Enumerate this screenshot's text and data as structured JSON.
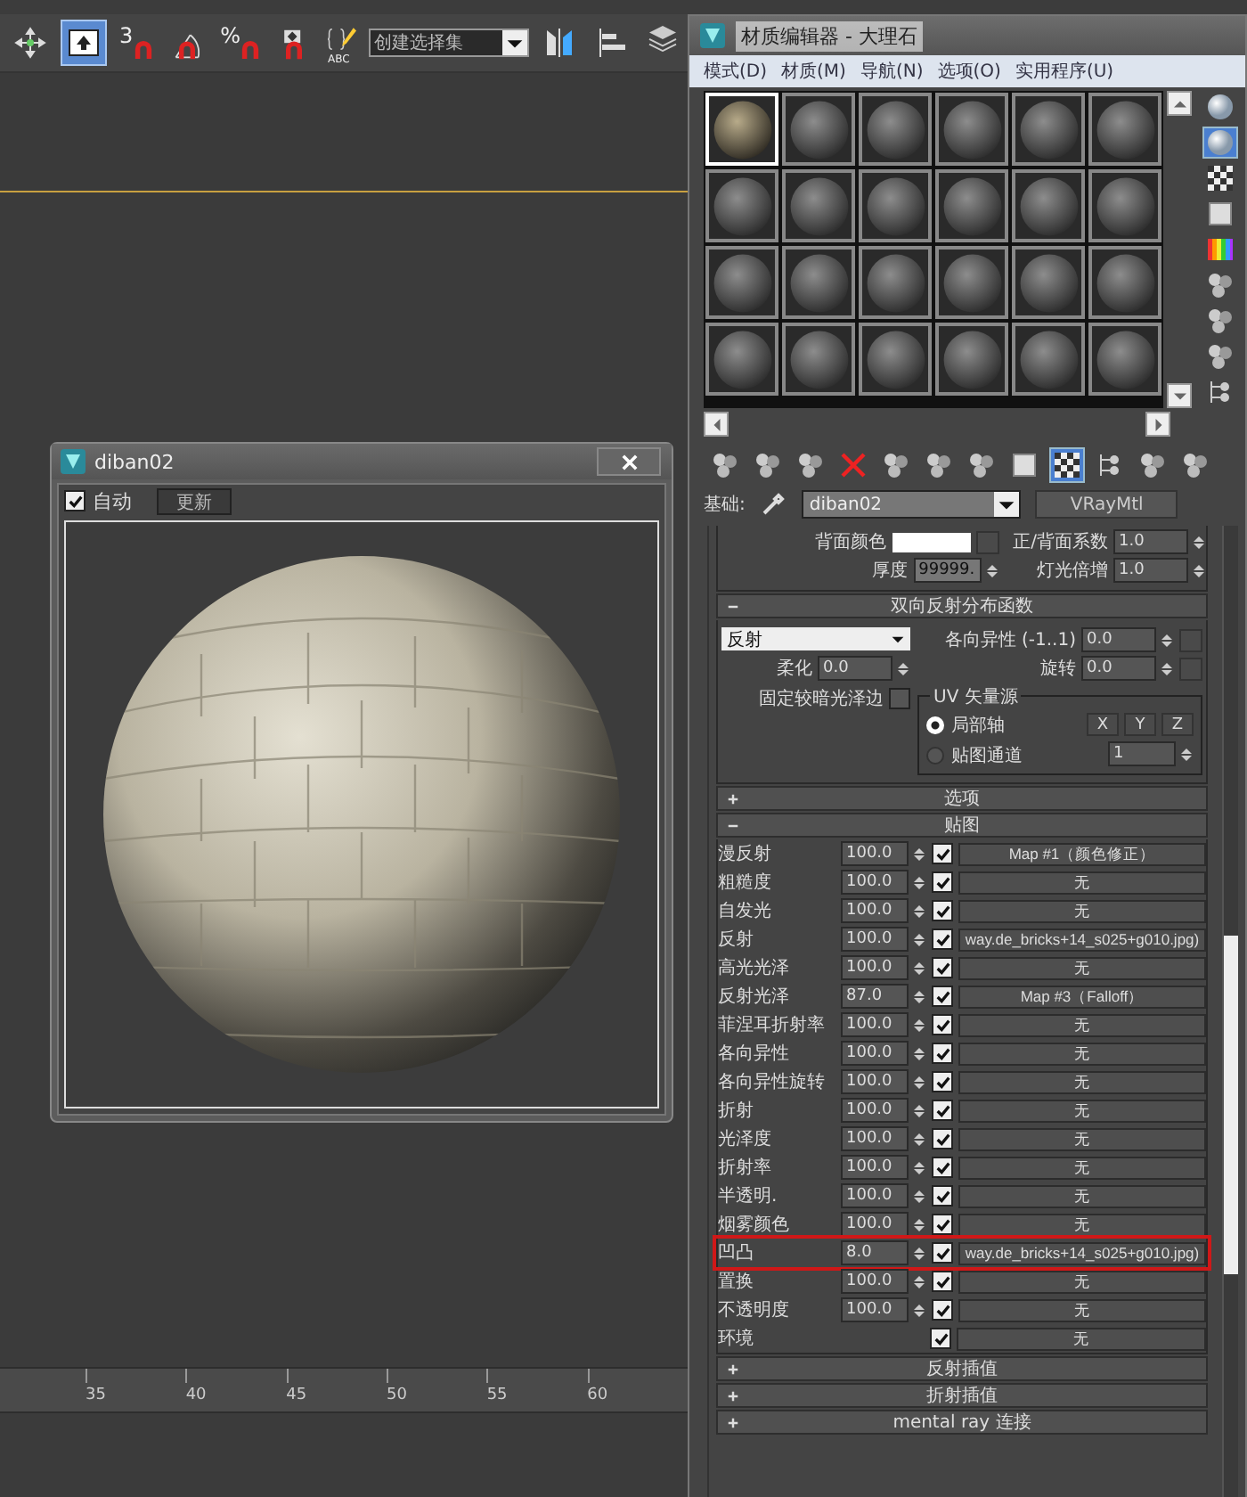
{
  "toolbar": {
    "items": [
      {
        "kind": "move",
        "selected": false
      },
      {
        "kind": "select-window",
        "selected": true
      },
      {
        "kind": "snap",
        "label": "3",
        "selected": false
      },
      {
        "kind": "angle-snap",
        "selected": false
      },
      {
        "kind": "percent-snap",
        "label": "%",
        "selected": false
      },
      {
        "kind": "spinner-snap",
        "selected": false
      },
      {
        "kind": "named-sets",
        "label": "ABC",
        "selected": false
      }
    ],
    "selection_set": "创建选择集",
    "tail": [
      {
        "kind": "mirror"
      },
      {
        "kind": "align"
      },
      {
        "kind": "layers"
      }
    ]
  },
  "timeline": {
    "ticks": [
      "35",
      "40",
      "45",
      "50",
      "55",
      "60"
    ]
  },
  "preview_window": {
    "title": "diban02",
    "auto_update": {
      "label": "自动",
      "checked": true
    },
    "update_button": "更新"
  },
  "material_editor": {
    "title": "材质编辑器 - 大理石",
    "menu": [
      "模式(D)",
      "材质(M)",
      "导航(N)",
      "选项(O)",
      "实用程序(U)"
    ],
    "slots": [
      {
        "kind": "textured",
        "selected": true
      },
      {
        "kind": "plain",
        "selected": false
      },
      {
        "kind": "plain",
        "selected": false
      },
      {
        "kind": "plain",
        "selected": false
      },
      {
        "kind": "plain",
        "selected": false
      },
      {
        "kind": "plain",
        "selected": false
      },
      {
        "kind": "plain",
        "selected": false
      },
      {
        "kind": "plain",
        "selected": false
      },
      {
        "kind": "plain",
        "selected": false
      },
      {
        "kind": "plain",
        "selected": false
      },
      {
        "kind": "plain",
        "selected": false
      },
      {
        "kind": "plain",
        "selected": false
      },
      {
        "kind": "plain",
        "selected": false
      },
      {
        "kind": "plain",
        "selected": false
      },
      {
        "kind": "plain",
        "selected": false
      },
      {
        "kind": "plain",
        "selected": false
      },
      {
        "kind": "plain",
        "selected": false
      },
      {
        "kind": "plain",
        "selected": false
      },
      {
        "kind": "plain",
        "selected": false
      },
      {
        "kind": "plain",
        "selected": false
      },
      {
        "kind": "plain",
        "selected": false
      },
      {
        "kind": "plain",
        "selected": false
      },
      {
        "kind": "plain",
        "selected": false
      },
      {
        "kind": "plain",
        "selected": false
      }
    ],
    "side_tools": [
      {
        "kind": "sphere",
        "selected": false
      },
      {
        "kind": "sphere",
        "selected": true
      },
      {
        "kind": "checker",
        "selected": false
      },
      {
        "kind": "square",
        "selected": false
      },
      {
        "kind": "color-bars",
        "selected": false
      },
      {
        "kind": "dots",
        "selected": false
      },
      {
        "kind": "dots",
        "selected": false
      },
      {
        "kind": "dots",
        "selected": false
      },
      {
        "kind": "tree",
        "selected": false
      }
    ],
    "bottom_tools": [
      {
        "kind": "dots",
        "selected": false
      },
      {
        "kind": "dots",
        "selected": false
      },
      {
        "kind": "dots",
        "selected": false
      },
      {
        "kind": "cross",
        "selected": false
      },
      {
        "kind": "dots",
        "selected": false
      },
      {
        "kind": "dots",
        "selected": false
      },
      {
        "kind": "dots",
        "selected": false
      },
      {
        "kind": "square",
        "selected": false
      },
      {
        "kind": "checker",
        "selected": true
      },
      {
        "kind": "tree",
        "selected": false
      },
      {
        "kind": "dots",
        "selected": false
      },
      {
        "kind": "dots",
        "selected": false
      }
    ],
    "type_label": "基础:",
    "material_name": "diban02",
    "material_type": "VRayMtl"
  },
  "basic_params": {
    "back_color_label": "背面颜色",
    "thickness_label": "厚度",
    "thickness": "99999.",
    "front_back_label": "正/背面系数",
    "front_back": "1.0",
    "light_mult_label": "灯光倍增",
    "light_mult": "1.0"
  },
  "rollouts": [
    {
      "kind": "brdf",
      "title": "双向反射分布函数",
      "expanded": true,
      "type": "反射",
      "anisotropy_label": "各向异性 (-1..1)",
      "anisotropy": "0.0",
      "rotation_label": "旋转",
      "rotation": "0.0",
      "soften_label": "柔化",
      "soften": "0.0",
      "fix_dark_label": "固定较暗光泽边",
      "fix_dark": false,
      "uv_group": "UV 矢量源",
      "uv_options": [
        {
          "label": "局部轴",
          "selected": true
        },
        {
          "label": "贴图通道",
          "selected": false
        }
      ],
      "axes": [
        "X",
        "Y",
        "Z"
      ],
      "channel": "1"
    },
    {
      "kind": "plain",
      "title": "选项",
      "expanded": false
    },
    {
      "kind": "maps",
      "title": "贴图",
      "expanded": true,
      "rows": [
        {
          "label": "漫反射",
          "amount": "100.0",
          "enabled": true,
          "map": "Map #1（颜色修正）",
          "highlighted": false
        },
        {
          "label": "粗糙度",
          "amount": "100.0",
          "enabled": true,
          "map": "无",
          "highlighted": false
        },
        {
          "label": "自发光",
          "amount": "100.0",
          "enabled": true,
          "map": "无",
          "highlighted": false
        },
        {
          "label": "反射",
          "amount": "100.0",
          "enabled": true,
          "map": "way.de_bricks+14_s025+g010.jpg)",
          "highlighted": false
        },
        {
          "label": "高光光泽",
          "amount": "100.0",
          "enabled": true,
          "map": "无",
          "highlighted": false
        },
        {
          "label": "反射光泽",
          "amount": "87.0",
          "enabled": true,
          "map": "Map #3（Falloff）",
          "highlighted": false
        },
        {
          "label": "菲涅耳折射率",
          "amount": "100.0",
          "enabled": true,
          "map": "无",
          "highlighted": false
        },
        {
          "label": "各向异性",
          "amount": "100.0",
          "enabled": true,
          "map": "无",
          "highlighted": false
        },
        {
          "label": "各向异性旋转",
          "amount": "100.0",
          "enabled": true,
          "map": "无",
          "highlighted": false
        },
        {
          "label": "折射",
          "amount": "100.0",
          "enabled": true,
          "map": "无",
          "highlighted": false
        },
        {
          "label": "光泽度",
          "amount": "100.0",
          "enabled": true,
          "map": "无",
          "highlighted": false
        },
        {
          "label": "折射率",
          "amount": "100.0",
          "enabled": true,
          "map": "无",
          "highlighted": false
        },
        {
          "label": "半透明.",
          "amount": "100.0",
          "enabled": true,
          "map": "无",
          "highlighted": false
        },
        {
          "label": "烟雾颜色",
          "amount": "100.0",
          "enabled": true,
          "map": "无",
          "highlighted": false
        },
        {
          "label": "凹凸",
          "amount": "8.0",
          "enabled": true,
          "map": "way.de_bricks+14_s025+g010.jpg)",
          "highlighted": true
        },
        {
          "label": "置换",
          "amount": "100.0",
          "enabled": true,
          "map": "无",
          "highlighted": false
        },
        {
          "label": "不透明度",
          "amount": "100.0",
          "enabled": true,
          "map": "无",
          "highlighted": false
        },
        {
          "label": "环境",
          "enabled": true,
          "map": "无",
          "highlighted": false
        }
      ]
    },
    {
      "kind": "plain",
      "title": "反射插值",
      "expanded": false
    },
    {
      "kind": "plain",
      "title": "折射插值",
      "expanded": false
    },
    {
      "kind": "plain",
      "title": "mental ray 连接",
      "expanded": false
    }
  ]
}
